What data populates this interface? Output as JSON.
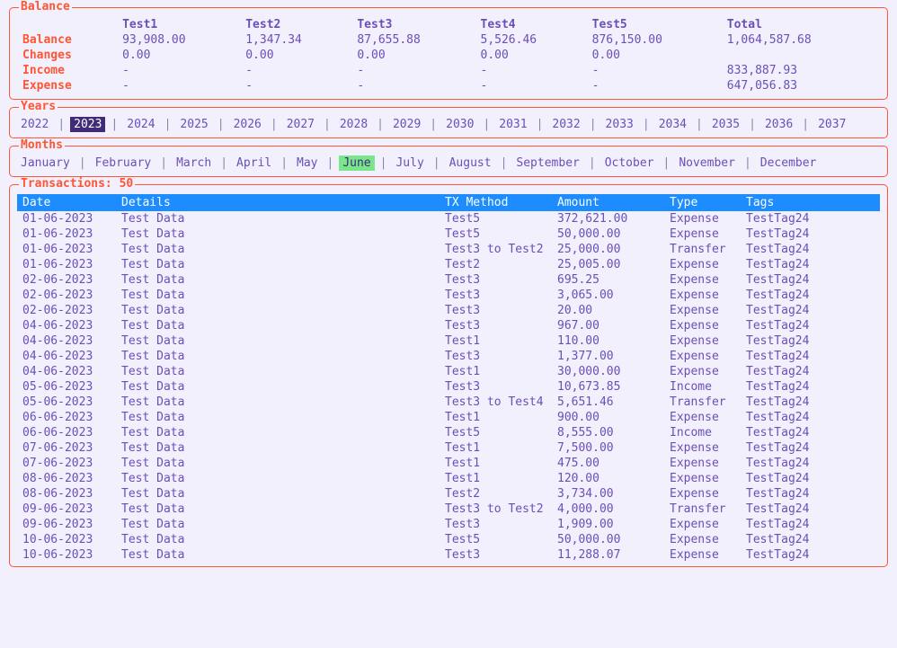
{
  "balance": {
    "title": "Balance",
    "headers": [
      "Test1",
      "Test2",
      "Test3",
      "Test4",
      "Test5",
      "Total"
    ],
    "rows": [
      {
        "label": "Balance",
        "cells": [
          "93,908.00",
          "1,347.34",
          "87,655.88",
          "5,526.46",
          "876,150.00",
          "1,064,587.68"
        ]
      },
      {
        "label": "Changes",
        "cells": [
          "0.00",
          "0.00",
          "0.00",
          "0.00",
          "0.00",
          ""
        ]
      },
      {
        "label": "Income",
        "cells": [
          "-",
          "-",
          "-",
          "-",
          "-",
          "833,887.93"
        ]
      },
      {
        "label": "Expense",
        "cells": [
          "-",
          "-",
          "-",
          "-",
          "-",
          "647,056.83"
        ]
      }
    ]
  },
  "years": {
    "title": "Years",
    "items": [
      "2022",
      "2023",
      "2024",
      "2025",
      "2026",
      "2027",
      "2028",
      "2029",
      "2030",
      "2031",
      "2032",
      "2033",
      "2034",
      "2035",
      "2036",
      "2037"
    ],
    "selected": "2023"
  },
  "months": {
    "title": "Months",
    "items": [
      "January",
      "February",
      "March",
      "April",
      "May",
      "June",
      "July",
      "August",
      "September",
      "October",
      "November",
      "December"
    ],
    "selected": "June"
  },
  "transactions": {
    "title": "Transactions: 50",
    "headers": {
      "date": "Date",
      "details": "Details",
      "method": "TX Method",
      "amount": "Amount",
      "type": "Type",
      "tags": "Tags"
    },
    "rows": [
      {
        "date": "01-06-2023",
        "details": "Test Data",
        "method": "Test5",
        "amount": "372,621.00",
        "type": "Expense",
        "tags": "TestTag24"
      },
      {
        "date": "01-06-2023",
        "details": "Test Data",
        "method": "Test5",
        "amount": "50,000.00",
        "type": "Expense",
        "tags": "TestTag24"
      },
      {
        "date": "01-06-2023",
        "details": "Test Data",
        "method": "Test3 to Test2",
        "amount": "25,000.00",
        "type": "Transfer",
        "tags": "TestTag24"
      },
      {
        "date": "01-06-2023",
        "details": "Test Data",
        "method": "Test2",
        "amount": "25,005.00",
        "type": "Expense",
        "tags": "TestTag24"
      },
      {
        "date": "02-06-2023",
        "details": "Test Data",
        "method": "Test3",
        "amount": "695.25",
        "type": "Expense",
        "tags": "TestTag24"
      },
      {
        "date": "02-06-2023",
        "details": "Test Data",
        "method": "Test3",
        "amount": "3,065.00",
        "type": "Expense",
        "tags": "TestTag24"
      },
      {
        "date": "02-06-2023",
        "details": "Test Data",
        "method": "Test3",
        "amount": "20.00",
        "type": "Expense",
        "tags": "TestTag24"
      },
      {
        "date": "04-06-2023",
        "details": "Test Data",
        "method": "Test3",
        "amount": "967.00",
        "type": "Expense",
        "tags": "TestTag24"
      },
      {
        "date": "04-06-2023",
        "details": "Test Data",
        "method": "Test1",
        "amount": "110.00",
        "type": "Expense",
        "tags": "TestTag24"
      },
      {
        "date": "04-06-2023",
        "details": "Test Data",
        "method": "Test3",
        "amount": "1,377.00",
        "type": "Expense",
        "tags": "TestTag24"
      },
      {
        "date": "04-06-2023",
        "details": "Test Data",
        "method": "Test1",
        "amount": "30,000.00",
        "type": "Expense",
        "tags": "TestTag24"
      },
      {
        "date": "05-06-2023",
        "details": "Test Data",
        "method": "Test3",
        "amount": "10,673.85",
        "type": "Income",
        "tags": "TestTag24"
      },
      {
        "date": "05-06-2023",
        "details": "Test Data",
        "method": "Test3 to Test4",
        "amount": "5,651.46",
        "type": "Transfer",
        "tags": "TestTag24"
      },
      {
        "date": "06-06-2023",
        "details": "Test Data",
        "method": "Test1",
        "amount": "900.00",
        "type": "Expense",
        "tags": "TestTag24"
      },
      {
        "date": "06-06-2023",
        "details": "Test Data",
        "method": "Test5",
        "amount": "8,555.00",
        "type": "Income",
        "tags": "TestTag24"
      },
      {
        "date": "07-06-2023",
        "details": "Test Data",
        "method": "Test1",
        "amount": "7,500.00",
        "type": "Expense",
        "tags": "TestTag24"
      },
      {
        "date": "07-06-2023",
        "details": "Test Data",
        "method": "Test1",
        "amount": "475.00",
        "type": "Expense",
        "tags": "TestTag24"
      },
      {
        "date": "08-06-2023",
        "details": "Test Data",
        "method": "Test1",
        "amount": "120.00",
        "type": "Expense",
        "tags": "TestTag24"
      },
      {
        "date": "08-06-2023",
        "details": "Test Data",
        "method": "Test2",
        "amount": "3,734.00",
        "type": "Expense",
        "tags": "TestTag24"
      },
      {
        "date": "09-06-2023",
        "details": "Test Data",
        "method": "Test3 to Test2",
        "amount": "4,000.00",
        "type": "Transfer",
        "tags": "TestTag24"
      },
      {
        "date": "09-06-2023",
        "details": "Test Data",
        "method": "Test3",
        "amount": "1,909.00",
        "type": "Expense",
        "tags": "TestTag24"
      },
      {
        "date": "10-06-2023",
        "details": "Test Data",
        "method": "Test5",
        "amount": "50,000.00",
        "type": "Expense",
        "tags": "TestTag24"
      },
      {
        "date": "10-06-2023",
        "details": "Test Data",
        "method": "Test3",
        "amount": "11,288.07",
        "type": "Expense",
        "tags": "TestTag24"
      }
    ]
  }
}
